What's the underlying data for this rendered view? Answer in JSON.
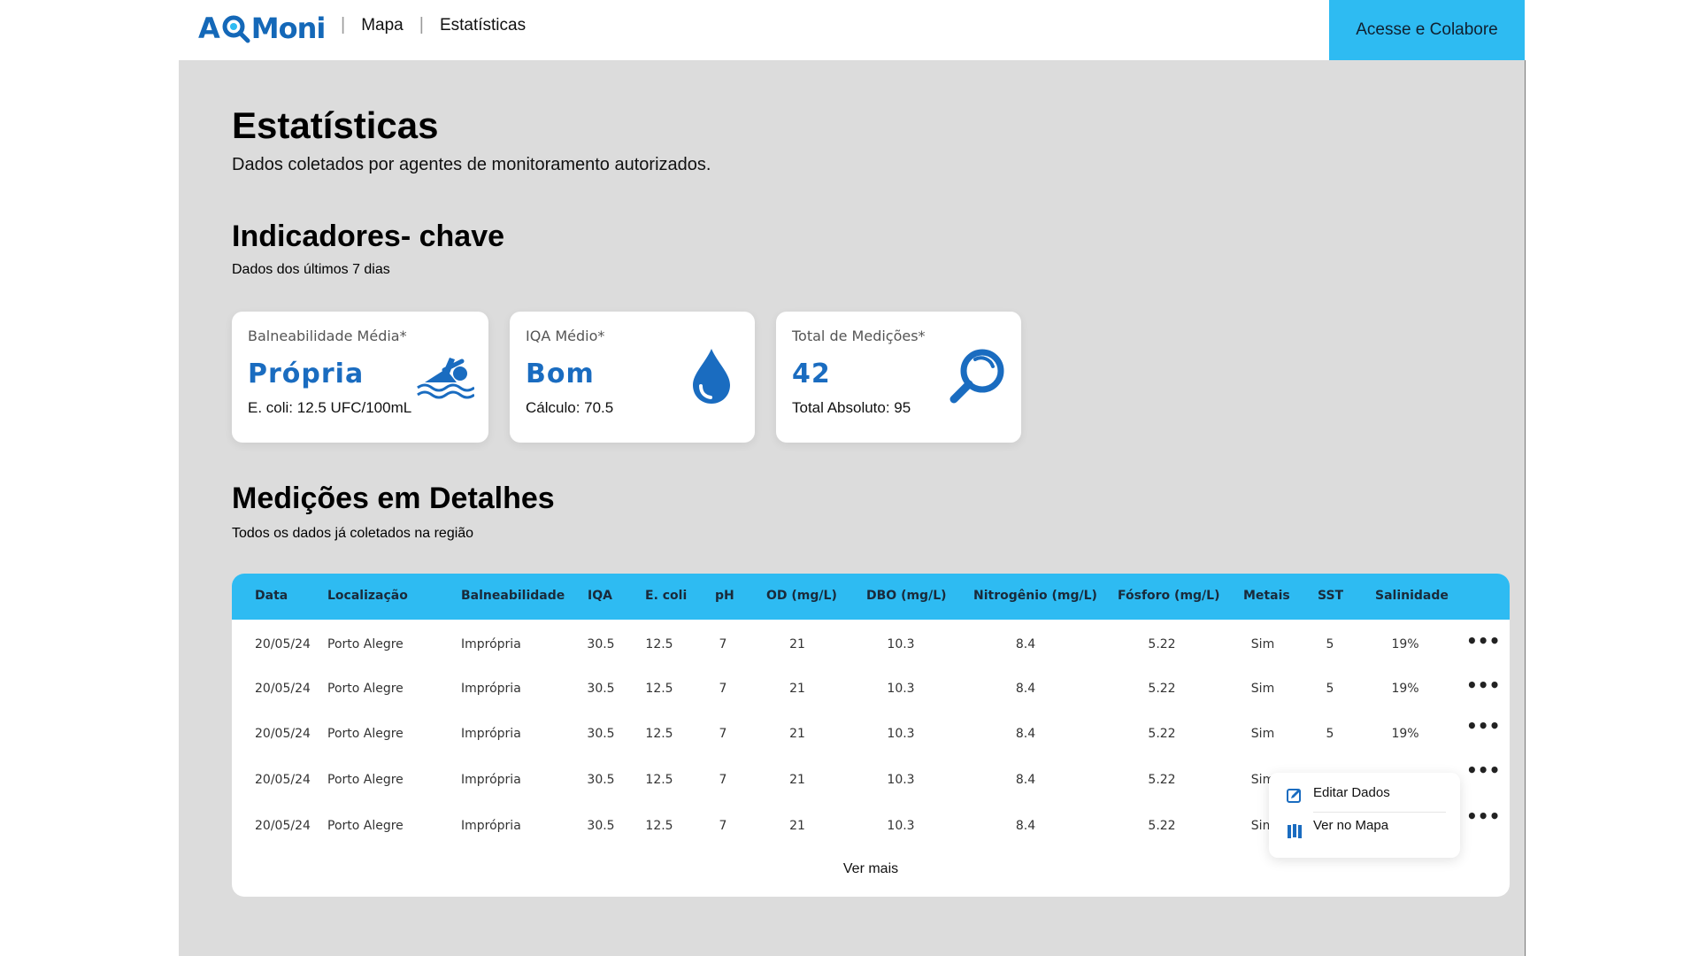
{
  "nav": {
    "logo_left": "AQ",
    "logo_right": "Moni",
    "links": [
      "Mapa",
      "Estatísticas"
    ],
    "cta": "Acesse e Colabore"
  },
  "page": {
    "title": "Estatísticas",
    "subtitle": "Dados coletados por agentes de monitoramento autorizados.",
    "kpi_title": "Indicadores- chave",
    "kpi_subtitle": "Dados dos últimos 7 dias",
    "table_title": "Medições em Detalhes",
    "table_subtitle": "Todos os dados já coletados na região"
  },
  "cards": [
    {
      "label": "Balneabilidade Média*",
      "value": "Própria",
      "note": "E. coli: 12.5 UFC/100mL",
      "icon": "swimmer-icon"
    },
    {
      "label": "IQA Médio*",
      "value": "Bom",
      "note": "Cálculo: 70.5",
      "icon": "water-drop-icon"
    },
    {
      "label": "Total de Medições*",
      "value": "42",
      "note": "Total Absoluto: 95",
      "icon": "magnifier-icon"
    }
  ],
  "table": {
    "headers": [
      "Data",
      "Localização",
      "Balneabilidade",
      "IQA",
      "E. coli",
      "pH",
      "OD (mg/L)",
      "DBO (mg/L)",
      "Nitrogênio (mg/L)",
      "Fósforo (mg/L)",
      "Metais",
      "SST",
      "Salinidade"
    ],
    "rows": [
      [
        "20/05/24",
        "Porto Alegre",
        "Imprópria",
        "30.5",
        "12.5",
        "7",
        "21",
        "10.3",
        "8.4",
        "5.22",
        "Sim",
        "5",
        "19%"
      ],
      [
        "20/05/24",
        "Porto Alegre",
        "Imprópria",
        "30.5",
        "12.5",
        "7",
        "21",
        "10.3",
        "8.4",
        "5.22",
        "Sim",
        "5",
        "19%"
      ],
      [
        "20/05/24",
        "Porto Alegre",
        "Imprópria",
        "30.5",
        "12.5",
        "7",
        "21",
        "10.3",
        "8.4",
        "5.22",
        "Sim",
        "5",
        "19%"
      ],
      [
        "20/05/24",
        "Porto Alegre",
        "Imprópria",
        "30.5",
        "12.5",
        "7",
        "21",
        "10.3",
        "8.4",
        "5.22",
        "Sim",
        "",
        ""
      ],
      [
        "20/05/24",
        "Porto Alegre",
        "Imprópria",
        "30.5",
        "12.5",
        "7",
        "21",
        "10.3",
        "8.4",
        "5.22",
        "Sim",
        "",
        ""
      ]
    ],
    "row_menu": "•••",
    "see_more": "Ver mais"
  },
  "context_menu": {
    "items": [
      {
        "label": "Editar Dados",
        "icon": "edit-icon"
      },
      {
        "label": "Ver no Mapa",
        "icon": "map-icon"
      }
    ]
  },
  "colors": {
    "accent": "#2ebbf2",
    "brand_blue": "#1a6cc0",
    "panel_bg": "#dcdcdc"
  }
}
